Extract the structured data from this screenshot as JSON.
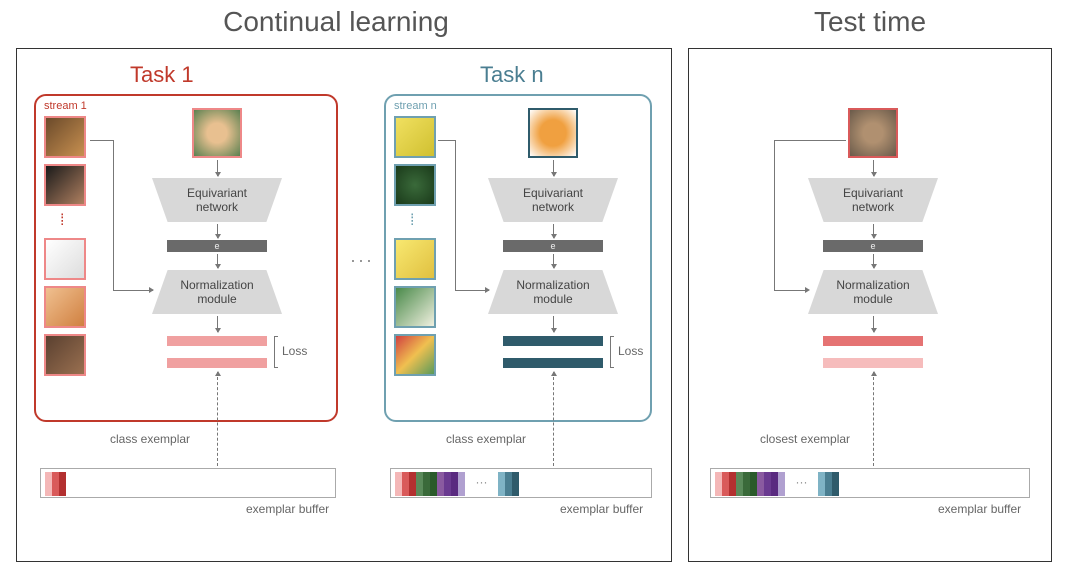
{
  "sections": {
    "left": "Continual learning",
    "right": "Test time"
  },
  "task1": {
    "title": "Task 1",
    "stream": "stream 1",
    "net": "Equivariant\nnetwork",
    "norm": "Normalization\nmodule",
    "loss": "Loss",
    "exemplar": "class exemplar",
    "buffer": "exemplar buffer",
    "feat": "e"
  },
  "taskn": {
    "title": "Task n",
    "stream": "stream n",
    "net": "Equivariant\nnetwork",
    "norm": "Normalization\nmodule",
    "loss": "Loss",
    "exemplar": "class exemplar",
    "buffer": "exemplar buffer",
    "feat": "e"
  },
  "test": {
    "net": "Equivariant\nnetwork",
    "norm": "Normalization\nmodule",
    "exemplar": "closest exemplar",
    "buffer": "exemplar buffer",
    "feat": "e"
  },
  "ellipsis": "···",
  "colors": {
    "red": "#c0392b",
    "lightred": "#e88",
    "pink": "#f0a0a0",
    "palepink": "#f6bcbc",
    "teal": "#4a7e91",
    "tealborder": "#6fa0b0",
    "darkteal": "#2f5b6b",
    "buf_reds": [
      "#f4b7b7",
      "#d95a5a",
      "#b33030"
    ],
    "buf_full": [
      "#f4b7b7",
      "#d95a5a",
      "#b33030",
      "#5a8a5a",
      "#3a6a3a",
      "#2a5a2a",
      "#8a5aa0",
      "#6a3a90",
      "#5a2a80",
      "#b0a0d0",
      "#7fb3c5",
      "#4a7e91",
      "#2f5b6b"
    ]
  }
}
